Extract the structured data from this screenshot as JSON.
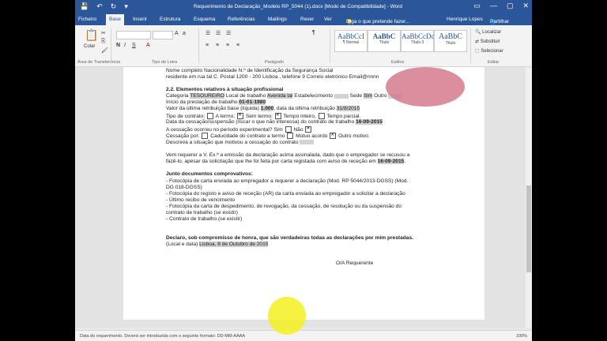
{
  "window": {
    "title": "Requerimento de Declaração_Modelo RP_5044 (1).docx [Modo de Compatibilidade] - Word",
    "user": "Henrique Lopes",
    "share": "Partilhar"
  },
  "tabs": [
    "Ficheiro",
    "Base",
    "Inserir",
    "Estrutura",
    "Esquema",
    "Referências",
    "Mailings",
    "Rever",
    "Ver"
  ],
  "active_tab": "Base",
  "tell_me": "Diga o que pretende fazer...",
  "ribbon": {
    "groups": [
      "Área de Transferência",
      "Tipo de Letra",
      "Parágrafo",
      "Estilos",
      "Editar"
    ],
    "paste": "Colar",
    "styles": [
      {
        "preview": "AaBbCcI",
        "name": "¶ Normal"
      },
      {
        "preview": "AaBbC",
        "name": "Título"
      },
      {
        "preview": "AaBbCcDc",
        "name": "Título 3"
      },
      {
        "preview": "AaBbC",
        "name": "Título"
      }
    ],
    "edit": [
      "Localizar",
      "Substituir",
      "Selecionar"
    ]
  },
  "document": {
    "line_top": "Nome completo                  Nacionalidade                    N.º de Identificação da Segurança Social",
    "line_addr": "residente em  rua tal  C. Postal  1200 - 200  Lisboa , telefone  9  Correio eletrónico  Email@nnnn",
    "section2_title": "2.2. Elementos relativos à situação profissional",
    "cat_pre": "Categoria",
    "cat_val": "TESOUREIRO",
    "cat_mid": "Local de trabalho",
    "cat_val2": "Avenida tal",
    "cat_post": "Estabelecimento",
    "cat_post2": "Sede",
    "cat_val3": "Sim",
    "cat_post3": "Outro",
    "inicio_pre": "Início da prestação de trabalho",
    "inicio_val": "01-01-1980",
    "valor_pre": "Valor da última retribuição base (líquida)",
    "valor_val": "1.000",
    "valor_mid": ", data da última retribuição",
    "valor_date": "31/8/2015",
    "tipo_pre": "Tipo de contrato:",
    "tipo_a": "A termo;",
    "tipo_b": "Sem termo;",
    "tipo_c": "Tempo inteiro,",
    "tipo_d": "Tempo parcial.",
    "data_pre": "Data da cessação/suspensão (riscar o que não interessa) do contrato de trabalho",
    "data_val": "16-09-2015",
    "exp_pre": "A cessação ocorreu no período experimental? Sim",
    "exp_no": "Não",
    "ces_pre": "Cessação por:",
    "ces_a": "Caducidade do contrato a termo",
    "ces_b": "Mútuo acordo",
    "ces_c": "Outro motivo.",
    "desc": "Descreva a situação que motivou a cessação do contrato",
    "req1": "Vem requerer a V. Ex.ª a emissão da declaração acima assinalada, dado que o empregador se recusou a",
    "req2_pre": "fazê-lo, apesar da solicitação que lhe foi feita por carta registada com aviso de receção em",
    "req2_val": "16-09-2015",
    "junto_title": "Junto documentos comprovativos:",
    "docs": [
      "-   Fotocópia de carta enviada ao empregador a requerer a declaração (Mod. RP 5044/2013-DGSS) (Mod.",
      "DG 018-DGSS)",
      "-  Fotocópia do registo e aviso de receção (AR) da carta enviada ao empregador a solicitar a declaração",
      "-  Último recibo de vencimento",
      "-  Fotocópia da carta de despedimento, de revogação, da cessação, de resolução ou da suspensão do",
      "contrato de trabalho (se existir)",
      "- Contrato de trabalho (se existir)"
    ],
    "declaro": "Declaro, sob compromisso de honra, que são verdadeiras todas as declarações por mim prestadas.",
    "local_pre": "(Local e data)",
    "local_val": "Lisboa, 8 de Outubro de 2015",
    "signature": "O/A Requerente"
  },
  "status": {
    "message": "Data do requerimento. Deverá ser introduzida com o seguinte formato:  DD-MM-AAAA",
    "zoom": "100%"
  },
  "colors": {
    "titlebar": "#2b579a",
    "ribbon": "#f3f3f3",
    "highlight": "#cfcfcf"
  }
}
